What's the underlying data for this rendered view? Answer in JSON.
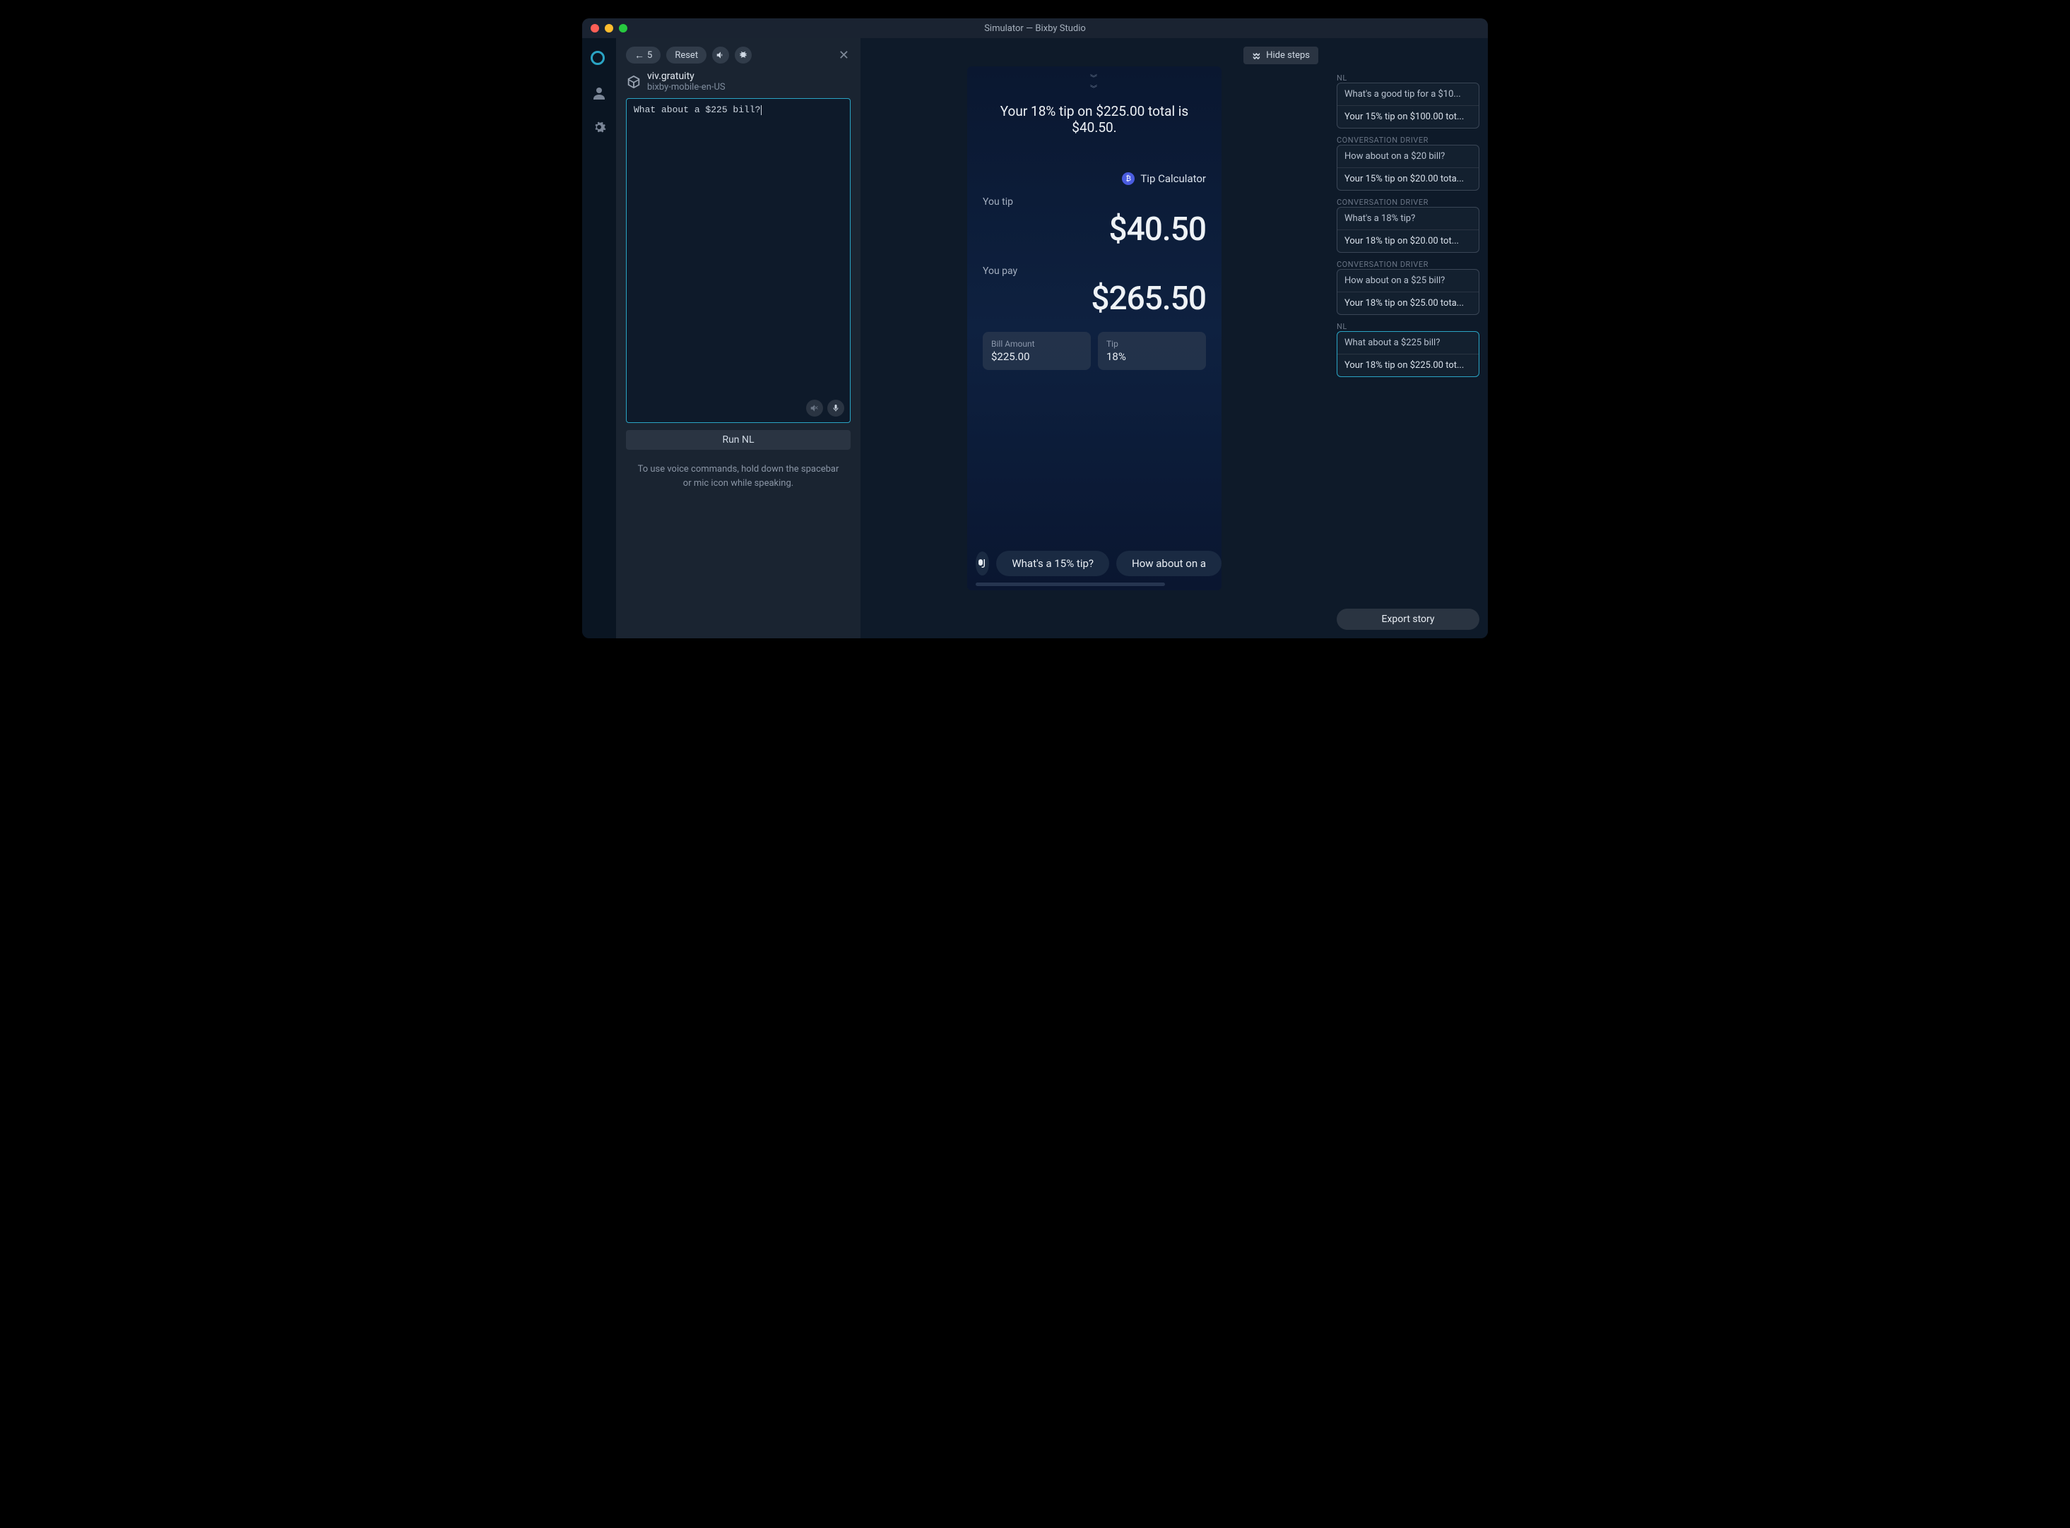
{
  "titlebar": {
    "title": "Simulator — Bixby Studio"
  },
  "toolbar": {
    "back_label": "5",
    "reset_label": "Reset"
  },
  "capsule": {
    "name": "viv.gratuity",
    "target": "bixby-mobile-en-US"
  },
  "nl": {
    "input_value": "What about a $225 bill?",
    "run_label": "Run NL",
    "hint": "To use voice commands, hold down the spacebar or mic icon while speaking."
  },
  "center": {
    "hide_steps_label": "Hide steps"
  },
  "device": {
    "summary": "Your 18% tip on $225.00 total is $40.50.",
    "app_name": "Tip Calculator",
    "tip_label": "You tip",
    "tip_amount": "$40.50",
    "pay_label": "You pay",
    "pay_amount": "$265.50",
    "bill_card_label": "Bill Amount",
    "bill_card_value": "$225.00",
    "tip_card_label": "Tip",
    "tip_card_value": "18%",
    "suggestion1": "What's a 15% tip?",
    "suggestion2": "How about on a"
  },
  "steps": [
    {
      "kind": "NL",
      "top": "What's a good tip for a $10...",
      "bot": "Your 15% tip on $100.00 tot..."
    },
    {
      "kind": "CONVERSATION DRIVER",
      "top": "How about on a $20 bill?",
      "bot": "Your 15% tip on $20.00 tota..."
    },
    {
      "kind": "CONVERSATION DRIVER",
      "top": "What's a 18% tip?",
      "bot": "Your 18% tip on $20.00 tot..."
    },
    {
      "kind": "CONVERSATION DRIVER",
      "top": "How about on a $25 bill?",
      "bot": "Your 18% tip on $25.00 tota..."
    },
    {
      "kind": "NL",
      "top": "What about a $225 bill?",
      "bot": "Your 18% tip on $225.00 tot...",
      "active": true
    }
  ],
  "export": {
    "label": "Export story"
  }
}
